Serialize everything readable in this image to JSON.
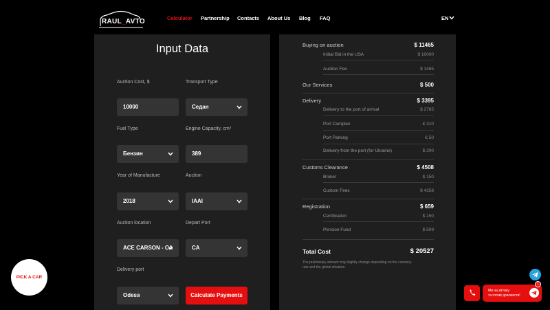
{
  "header": {
    "logo_main": "RAUL",
    "logo_dash": "_",
    "logo_end": "AVTO",
    "nav": [
      "Calculator",
      "Partnership",
      "Contacts",
      "About Us",
      "Blog",
      "FAQ"
    ],
    "language": "EN"
  },
  "form": {
    "title": "Input Data",
    "auction_cost_label": "Auction Cost, $",
    "auction_cost_value": "10000",
    "transport_type_label": "Transport Type",
    "transport_type_value": "Седан",
    "fuel_type_label": "Fuel Type",
    "fuel_type_value": "Бензин",
    "engine_capacity_label": "Engine Capacity, cm³",
    "engine_capacity_value": "389",
    "year_label": "Year of Manufacture",
    "year_value": "2018",
    "auction_label": "Auction",
    "auction_value": "IAAI",
    "auction_location_label": "Auction location",
    "auction_location_value": "ACE CARSON - CA",
    "depart_port_label": "Depart Port",
    "depart_port_value": "CA",
    "delivery_port_label": "Delivery port",
    "delivery_port_value": "Odesa",
    "calculate_button": "Calculate Payments"
  },
  "summary": {
    "buying_label": "Buying on auction",
    "buying_value": "$ 11465",
    "initial_bid_label": "Initial Bid in the USA",
    "initial_bid_value": "$ 10000",
    "auction_fee_label": "Auction Fee",
    "auction_fee_value": "$ 1465",
    "services_label": "Our Services",
    "services_value": "$ 500",
    "delivery_label": "Delivery",
    "delivery_value": "$ 3395",
    "delivery_port_label": "Delivery to the port of arrival",
    "delivery_port_value": "$ 2785",
    "port_complex_label": "Port Complex",
    "port_complex_value": "€ 310",
    "port_parking_label": "Port Parking",
    "port_parking_value": "€ 50",
    "delivery_ukraine_label": "Delivery from the port (for Ukraine)",
    "delivery_ukraine_value": "$ 200",
    "customs_label": "Customs Clearance",
    "customs_value": "$ 4508",
    "broker_label": "Broker",
    "broker_value": "$ 150",
    "customs_fees_label": "Custom Fees",
    "customs_fees_value": "$ 4358",
    "registration_label": "Registration",
    "registration_value": "$ 659",
    "certification_label": "Certification",
    "certification_value": "$ 150",
    "pension_label": "Pension Fund",
    "pension_value": "$ 509",
    "total_label": "Total Cost",
    "total_value": "$ 20527",
    "disclaimer": "The preliminary amount may slightly change depending on the currency rate and the global situation."
  },
  "floating": {
    "pick_car": "PICK A CAR",
    "help_line1": "Ми на зв'язку",
    "help_line2": "та готові допомогти!",
    "badge": "1"
  },
  "colors": {
    "accent": "#e60f0f",
    "panel": "#1f1f1f",
    "field": "#343434",
    "telegram": "#2aa3dd"
  }
}
